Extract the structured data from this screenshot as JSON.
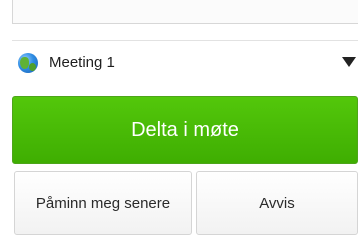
{
  "meeting": {
    "name": "Meeting 1",
    "icon": "globe-icon"
  },
  "actions": {
    "join_label": "Delta i møte",
    "remind_label": "Påminn meg senere",
    "decline_label": "Avvis"
  },
  "colors": {
    "join_button": "#47b806",
    "secondary_button": "#f5f5f5",
    "caret": "#222222"
  }
}
